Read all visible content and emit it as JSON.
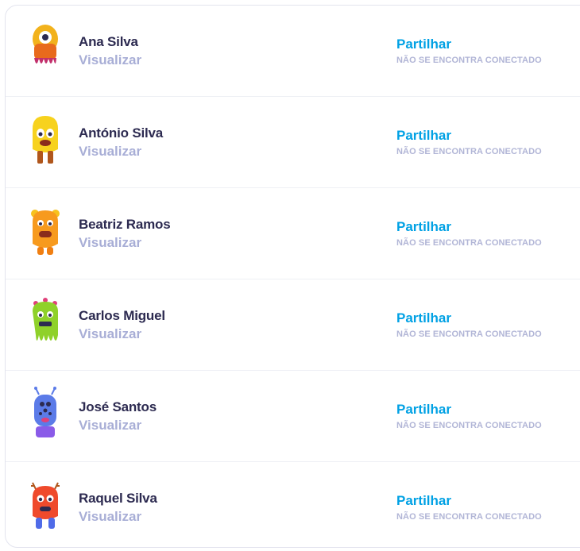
{
  "students": [
    {
      "name": "Ana Silva",
      "view_label": "Visualizar",
      "share_label": "Partilhar",
      "status": "NÃO SE ENCONTRA CONECTADO",
      "avatar": "yellow-cyclops-monster",
      "color": "#f2b21c"
    },
    {
      "name": "António Silva",
      "view_label": "Visualizar",
      "share_label": "Partilhar",
      "status": "NÃO SE ENCONTRA CONECTADO",
      "avatar": "yellow-hairy-monster",
      "color": "#f7d21e"
    },
    {
      "name": "Beatriz Ramos",
      "view_label": "Visualizar",
      "share_label": "Partilhar",
      "status": "NÃO SE ENCONTRA CONECTADO",
      "avatar": "orange-bear-monster",
      "color": "#f79a1e"
    },
    {
      "name": "Carlos Miguel",
      "view_label": "Visualizar",
      "share_label": "Partilhar",
      "status": "NÃO SE ENCONTRA CONECTADO",
      "avatar": "green-slime-monster",
      "color": "#8fd12a"
    },
    {
      "name": "José Santos",
      "view_label": "Visualizar",
      "share_label": "Partilhar",
      "status": "NÃO SE ENCONTRA CONECTADO",
      "avatar": "blue-spotted-monster",
      "color": "#5b7be8"
    },
    {
      "name": "Raquel Silva",
      "view_label": "Visualizar",
      "share_label": "Partilhar",
      "status": "NÃO SE ENCONTRA CONECTADO",
      "avatar": "red-antler-monster",
      "color": "#ef4a2c"
    }
  ]
}
